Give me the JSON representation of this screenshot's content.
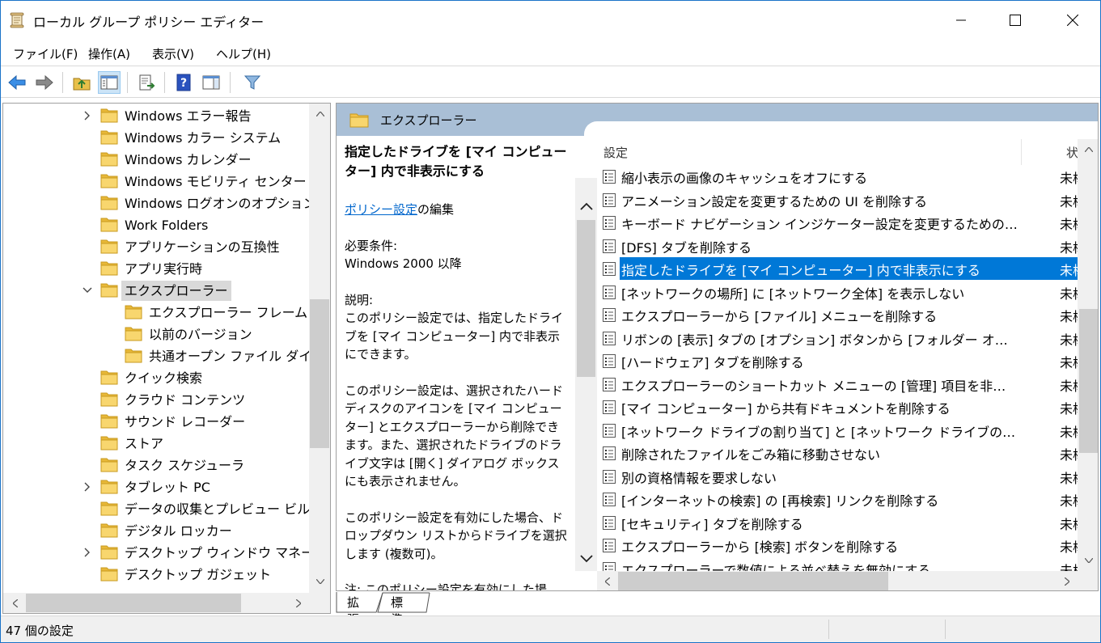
{
  "window": {
    "title": "ローカル グループ ポリシー エディター"
  },
  "menu": {
    "file": "ファイル(F)",
    "action": "操作(A)",
    "view": "表示(V)",
    "help": "ヘルプ(H)"
  },
  "tree": {
    "items": [
      {
        "label": "Windows エラー報告",
        "level": 1,
        "expander": "collapsed"
      },
      {
        "label": "Windows カラー システム",
        "level": 1,
        "expander": "none"
      },
      {
        "label": "Windows カレンダー",
        "level": 1,
        "expander": "none"
      },
      {
        "label": "Windows モビリティ センター",
        "level": 1,
        "expander": "none"
      },
      {
        "label": "Windows ログオンのオプション",
        "level": 1,
        "expander": "none"
      },
      {
        "label": "Work Folders",
        "level": 1,
        "expander": "none"
      },
      {
        "label": "アプリケーションの互換性",
        "level": 1,
        "expander": "none"
      },
      {
        "label": "アプリ実行時",
        "level": 1,
        "expander": "none"
      },
      {
        "label": "エクスプローラー",
        "level": 1,
        "expander": "expanded",
        "selected": true
      },
      {
        "label": "エクスプローラー フレーム ウィンド",
        "level": 2,
        "expander": "none"
      },
      {
        "label": "以前のバージョン",
        "level": 2,
        "expander": "none"
      },
      {
        "label": "共通オープン ファイル ダイアログ",
        "level": 2,
        "expander": "none"
      },
      {
        "label": "クイック検索",
        "level": 1,
        "expander": "none"
      },
      {
        "label": "クラウド コンテンツ",
        "level": 1,
        "expander": "none"
      },
      {
        "label": "サウンド レコーダー",
        "level": 1,
        "expander": "none"
      },
      {
        "label": "ストア",
        "level": 1,
        "expander": "none"
      },
      {
        "label": "タスク スケジューラ",
        "level": 1,
        "expander": "none"
      },
      {
        "label": "タブレット PC",
        "level": 1,
        "expander": "collapsed"
      },
      {
        "label": "データの収集とプレビュー ビルド",
        "level": 1,
        "expander": "none"
      },
      {
        "label": "デジタル ロッカー",
        "level": 1,
        "expander": "none"
      },
      {
        "label": "デスクトップ ウィンドウ マネージャー",
        "level": 1,
        "expander": "collapsed"
      },
      {
        "label": "デスクトップ ガジェット",
        "level": 1,
        "expander": "none"
      }
    ]
  },
  "right": {
    "header_title": "エクスプローラー",
    "desc": {
      "title": "指定したドライブを [マイ コンピューター] 内で非表示にする",
      "edit_link": "ポリシー設定",
      "edit_suffix": "の編集",
      "req_label": "必要条件:",
      "req_value": "Windows 2000 以降",
      "desc_label": "説明:",
      "para1": "このポリシー設定では、指定したドライブを [マイ コンピューター] 内で非表示にできます。",
      "para2": "このポリシー設定は、選択されたハード ディスクのアイコンを [マイ コンピューター] とエクスプローラーから削除できます。また、選択されたドライブのドライブ文字は [開く] ダイアログ ボックスにも表示されません。",
      "para3": "このポリシー設定を有効にした場合、ドロップダウン リストからドライブを選択します (複数可)。",
      "para4": "注: このポリシー設定を有効にした場"
    },
    "list": {
      "col_setting": "設定",
      "col_state": "状",
      "rows": [
        {
          "text": "縮小表示の画像のキャッシュをオフにする",
          "state": "未構"
        },
        {
          "text": "アニメーション設定を変更するための UI を削除する",
          "state": "未構"
        },
        {
          "text": "キーボード ナビゲーション インジケーター設定を変更するための UI を削除...",
          "state": "未構"
        },
        {
          "text": "[DFS] タブを削除する",
          "state": "未構"
        },
        {
          "text": "指定したドライブを [マイ コンピューター] 内で非表示にする",
          "state": "未構",
          "selected": true
        },
        {
          "text": "[ネットワークの場所] に [ネットワーク全体] を表示しない",
          "state": "未構"
        },
        {
          "text": "エクスプローラーから [ファイル] メニューを削除する",
          "state": "未構"
        },
        {
          "text": "リボンの [表示] タブの [オプション] ボタンから [フォルダー オプション] を...",
          "state": "未構"
        },
        {
          "text": "[ハードウェア] タブを削除する",
          "state": "未構"
        },
        {
          "text": "エクスプローラーのショートカット メニューの [管理] 項目を非表示にする",
          "state": "未構"
        },
        {
          "text": "[マイ コンピューター] から共有ドキュメントを削除する",
          "state": "未構"
        },
        {
          "text": "[ネットワーク ドライブの割り当て] と [ネットワーク ドライブの切断] 項目...",
          "state": "未構"
        },
        {
          "text": "削除されたファイルをごみ箱に移動させない",
          "state": "未構"
        },
        {
          "text": "別の資格情報を要求しない",
          "state": "未構"
        },
        {
          "text": "[インターネットの検索] の [再検索] リンクを削除する",
          "state": "未構"
        },
        {
          "text": "[セキュリティ] タブを削除する",
          "state": "未構"
        },
        {
          "text": "エクスプローラーから [検索] ボタンを削除する",
          "state": "未構"
        },
        {
          "text": "エクスプローラーで数値による並べ替えを無効にする",
          "state": "未構"
        }
      ]
    }
  },
  "tabs": {
    "extended": "拡張",
    "standard": "標準"
  },
  "status": {
    "text": "47 個の設定"
  },
  "colors": {
    "selection": "#0078d7",
    "header": "#a9bfd6",
    "folder": "#f3c34b",
    "link": "#0066cc"
  }
}
